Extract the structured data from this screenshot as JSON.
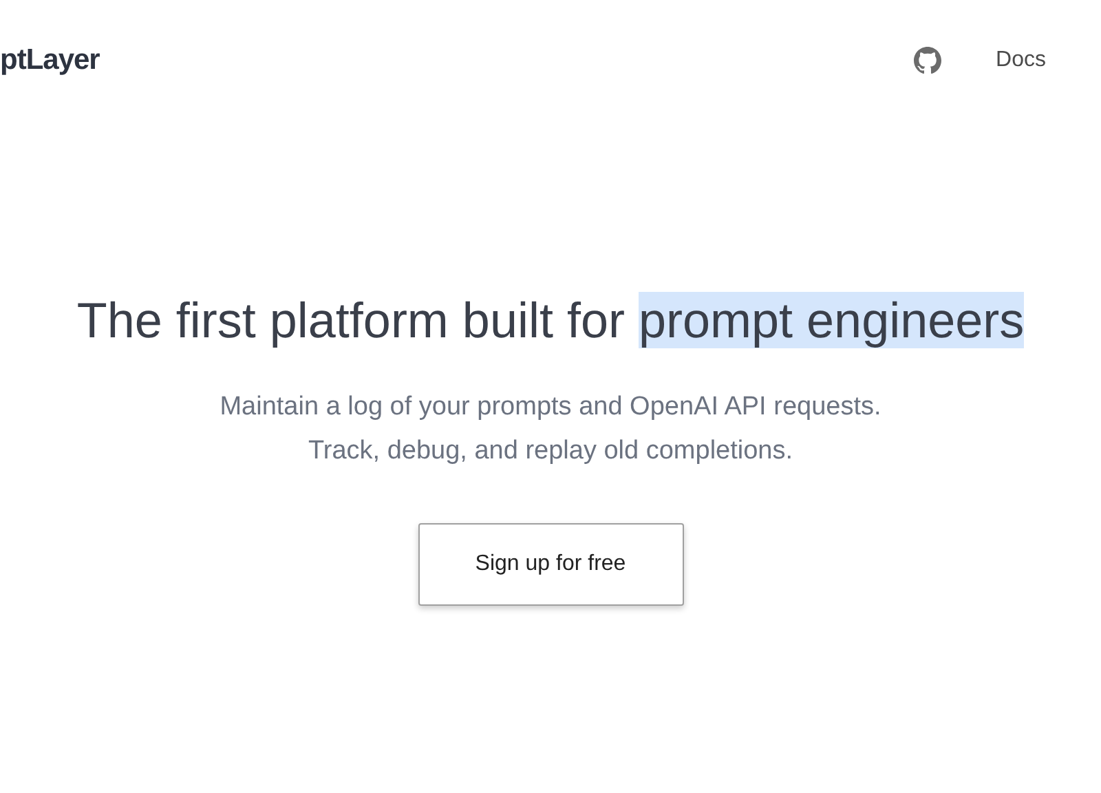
{
  "header": {
    "logo": "ptLayer",
    "nav": [
      {
        "kind": "github"
      },
      {
        "kind": "link",
        "label": "Docs"
      }
    ]
  },
  "hero": {
    "headline": [
      {
        "text": "The first platform built for ",
        "selected": false
      },
      {
        "text": "prompt engineers",
        "selected": true
      }
    ],
    "subtitle": [
      "Maintain a log of your prompts and OpenAI API requests.",
      "Track, debug, and replay old completions."
    ],
    "cta": "Sign up for free"
  }
}
